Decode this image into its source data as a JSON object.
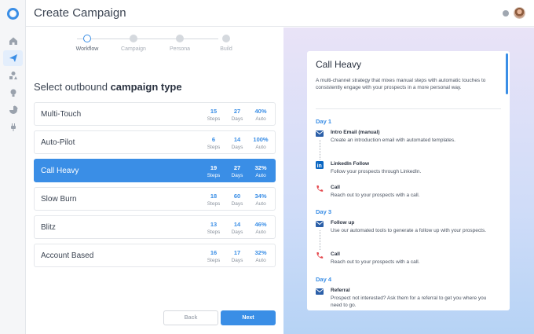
{
  "header": {
    "title": "Create Campaign"
  },
  "sidebar": {
    "items": [
      {
        "icon": "home-icon"
      },
      {
        "icon": "paper-plane-icon",
        "active": true
      },
      {
        "icon": "shapes-icon"
      },
      {
        "icon": "lightbulb-icon"
      },
      {
        "icon": "pie-chart-icon"
      },
      {
        "icon": "plug-icon"
      }
    ]
  },
  "stepper": {
    "steps": [
      "Workflow",
      "Campaign",
      "Persona",
      "Build"
    ],
    "current": 0
  },
  "left": {
    "heading_prefix": "Select outbound ",
    "heading_bold": "campaign type",
    "stat_labels": {
      "steps": "Steps",
      "days": "Days",
      "auto": "Auto"
    },
    "types": [
      {
        "name": "Multi-Touch",
        "steps": "15",
        "days": "27",
        "auto": "40%"
      },
      {
        "name": "Auto-Pilot",
        "steps": "6",
        "days": "14",
        "auto": "100%"
      },
      {
        "name": "Call Heavy",
        "steps": "19",
        "days": "27",
        "auto": "32%",
        "selected": true
      },
      {
        "name": "Slow Burn",
        "steps": "18",
        "days": "60",
        "auto": "34%"
      },
      {
        "name": "Blitz",
        "steps": "13",
        "days": "14",
        "auto": "46%"
      },
      {
        "name": "Account Based",
        "steps": "16",
        "days": "17",
        "auto": "32%"
      }
    ],
    "back_label": "Back",
    "next_label": "Next"
  },
  "detail": {
    "title": "Call Heavy",
    "description": "A multi-channel strategy that mixes manual steps with automatic touches to consistently engage with your prospects in a more personal way.",
    "days": [
      {
        "label": "Day 1",
        "activities": [
          {
            "icon": "mail-icon",
            "title": "Intro Email (manual)",
            "desc": "Create an introduction email with automated templates."
          },
          {
            "icon": "linkedin-icon",
            "title": "LinkedIn Follow",
            "desc": "Follow your prospects through LinkedIn."
          },
          {
            "icon": "phone-icon",
            "title": "Call",
            "desc": "Reach out to your prospects with a call."
          }
        ]
      },
      {
        "label": "Day 3",
        "activities": [
          {
            "icon": "mail-icon",
            "title": "Follow up",
            "desc": "Use our automated tools to generate a follow up with your prospects."
          },
          {
            "icon": "phone-icon",
            "title": "Call",
            "desc": "Reach out to your prospects with a call."
          }
        ]
      },
      {
        "label": "Day 4",
        "activities": [
          {
            "icon": "mail-icon",
            "title": "Referral",
            "desc": "Prospect not interested? Ask them for a referral to get you where you need to go."
          }
        ]
      }
    ]
  },
  "colors": {
    "accent": "#3a8ee6",
    "phone": "#e5484d",
    "mail": "#2b5fa8",
    "linkedin": "#0a66c2"
  }
}
